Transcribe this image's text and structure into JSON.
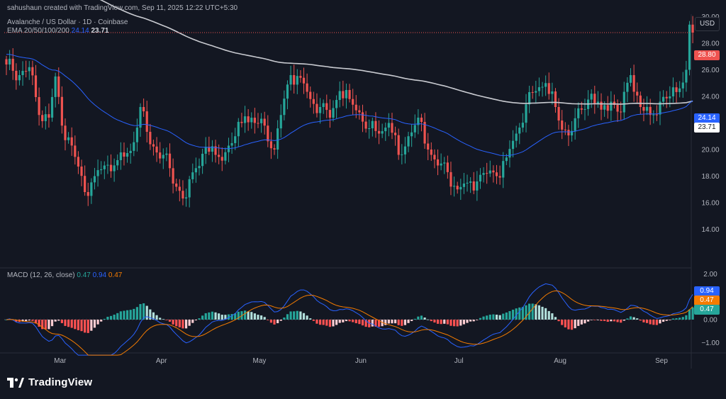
{
  "header": {
    "attribution": "sahushaun created with TradingView.com, Sep 11, 2025 12:22 UTC+5:30",
    "symbol_line": "Avalanche / US Dollar · 1D · Coinbase",
    "ema_label": "EMA 20/50/100/200",
    "ema_value_1": "24.14",
    "ema_value_2": "23.71",
    "currency": "USD"
  },
  "macd_header": {
    "label": "MACD (12, 26, close)",
    "hist": "0.47",
    "macd": "0.94",
    "signal": "0.47"
  },
  "footer": {
    "brand": "TradingView"
  },
  "colors": {
    "background": "#131722",
    "up": "#26a69a",
    "down": "#ef5350",
    "ema_fast": "#2962ff",
    "ema_slow": "#c9cbd1",
    "macd_line": "#2962ff",
    "signal_line": "#f57c00",
    "price_line": "#ef5350"
  },
  "chart_data": [
    {
      "type": "candlestick",
      "title": "Avalanche / US Dollar · 1D · Coinbase",
      "x_ticks": [
        "Mar",
        "Apr",
        "May",
        "Jun",
        "Jul",
        "Aug",
        "Sep"
      ],
      "y_ticks": [
        "30.00",
        "28.00",
        "26.00",
        "24.00",
        "22.00",
        "20.00",
        "18.00",
        "16.00",
        "14.00"
      ],
      "ylim": [
        13.5,
        30.5
      ],
      "close_anchors": [
        {
          "date": "2025-02-13",
          "close": 26.4
        },
        {
          "date": "2025-02-17",
          "close": 25.6
        },
        {
          "date": "2025-02-20",
          "close": 26.2
        },
        {
          "date": "2025-02-23",
          "close": 22.6
        },
        {
          "date": "2025-02-26",
          "close": 22.4
        },
        {
          "date": "2025-02-28",
          "close": 25.5
        },
        {
          "date": "2025-03-02",
          "close": 21.8
        },
        {
          "date": "2025-03-05",
          "close": 20.3
        },
        {
          "date": "2025-03-09",
          "close": 16.8
        },
        {
          "date": "2025-03-12",
          "close": 18.0
        },
        {
          "date": "2025-03-15",
          "close": 18.8
        },
        {
          "date": "2025-03-19",
          "close": 19.2
        },
        {
          "date": "2025-03-23",
          "close": 19.9
        },
        {
          "date": "2025-03-26",
          "close": 23.2
        },
        {
          "date": "2025-03-29",
          "close": 20.4
        },
        {
          "date": "2025-04-02",
          "close": 19.6
        },
        {
          "date": "2025-04-06",
          "close": 17.2
        },
        {
          "date": "2025-04-09",
          "close": 16.4
        },
        {
          "date": "2025-04-12",
          "close": 18.6
        },
        {
          "date": "2025-04-15",
          "close": 20.2
        },
        {
          "date": "2025-04-18",
          "close": 19.6
        },
        {
          "date": "2025-04-21",
          "close": 19.8
        },
        {
          "date": "2025-04-24",
          "close": 21.0
        },
        {
          "date": "2025-04-27",
          "close": 22.5
        },
        {
          "date": "2025-04-30",
          "close": 22.0
        },
        {
          "date": "2025-05-03",
          "close": 21.8
        },
        {
          "date": "2025-05-06",
          "close": 20.0
        },
        {
          "date": "2025-05-08",
          "close": 22.6
        },
        {
          "date": "2025-05-11",
          "close": 25.6
        },
        {
          "date": "2025-05-14",
          "close": 25.4
        },
        {
          "date": "2025-05-17",
          "close": 23.8
        },
        {
          "date": "2025-05-20",
          "close": 23.2
        },
        {
          "date": "2025-05-23",
          "close": 22.4
        },
        {
          "date": "2025-05-26",
          "close": 24.4
        },
        {
          "date": "2025-05-29",
          "close": 23.8
        },
        {
          "date": "2025-06-01",
          "close": 22.8
        },
        {
          "date": "2025-06-04",
          "close": 21.6
        },
        {
          "date": "2025-06-07",
          "close": 21.2
        },
        {
          "date": "2025-06-10",
          "close": 22.0
        },
        {
          "date": "2025-06-13",
          "close": 19.6
        },
        {
          "date": "2025-06-16",
          "close": 21.0
        },
        {
          "date": "2025-06-19",
          "close": 22.4
        },
        {
          "date": "2025-06-22",
          "close": 20.0
        },
        {
          "date": "2025-06-25",
          "close": 18.8
        },
        {
          "date": "2025-06-28",
          "close": 18.3
        },
        {
          "date": "2025-07-01",
          "close": 17.0
        },
        {
          "date": "2025-07-04",
          "close": 17.5
        },
        {
          "date": "2025-07-07",
          "close": 17.6
        },
        {
          "date": "2025-07-10",
          "close": 18.2
        },
        {
          "date": "2025-07-13",
          "close": 18.0
        },
        {
          "date": "2025-07-16",
          "close": 19.4
        },
        {
          "date": "2025-07-19",
          "close": 21.2
        },
        {
          "date": "2025-07-22",
          "close": 23.4
        },
        {
          "date": "2025-07-25",
          "close": 24.4
        },
        {
          "date": "2025-07-28",
          "close": 25.0
        },
        {
          "date": "2025-07-31",
          "close": 23.2
        },
        {
          "date": "2025-08-02",
          "close": 21.5
        },
        {
          "date": "2025-08-05",
          "close": 21.4
        },
        {
          "date": "2025-08-08",
          "close": 23.0
        },
        {
          "date": "2025-08-11",
          "close": 24.2
        },
        {
          "date": "2025-08-14",
          "close": 23.0
        },
        {
          "date": "2025-08-17",
          "close": 23.6
        },
        {
          "date": "2025-08-20",
          "close": 22.8
        },
        {
          "date": "2025-08-23",
          "close": 25.6
        },
        {
          "date": "2025-08-26",
          "close": 23.2
        },
        {
          "date": "2025-08-29",
          "close": 22.6
        },
        {
          "date": "2025-09-01",
          "close": 23.6
        },
        {
          "date": "2025-09-04",
          "close": 24.0
        },
        {
          "date": "2025-09-07",
          "close": 24.6
        },
        {
          "date": "2025-09-09",
          "close": 26.0
        },
        {
          "date": "2025-09-10",
          "close": 29.4
        },
        {
          "date": "2025-09-11",
          "close": 28.8
        }
      ],
      "last_price": "28.80",
      "ema_fast_last": "24.14",
      "ema_slow_last": "23.71",
      "series": [
        {
          "name": "EMA 20/50/100/200",
          "values": [
            "24.14",
            "23.71"
          ]
        }
      ]
    },
    {
      "type": "macd",
      "title": "MACD (12, 26, close)",
      "y_ticks": [
        "2.00",
        "1.00",
        "0.00",
        "−1.00"
      ],
      "ylim": [
        -1.4,
        2.2
      ],
      "last_values": {
        "histogram": "0.47",
        "macd": "0.94",
        "signal": "0.47"
      }
    }
  ]
}
